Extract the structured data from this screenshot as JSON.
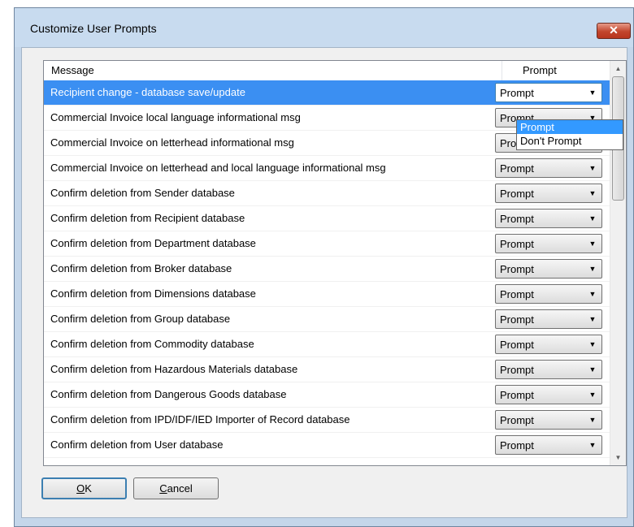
{
  "window": {
    "title": "Customize User Prompts",
    "close_glyph": "✕"
  },
  "grid": {
    "columns": [
      "Message",
      "Prompt"
    ],
    "rows": [
      {
        "message": "Recipient change - database save/update",
        "prompt": "Prompt"
      },
      {
        "message": "Commercial Invoice local language informational msg",
        "prompt": "Prompt"
      },
      {
        "message": "Commercial Invoice on letterhead informational msg",
        "prompt": "Prompt"
      },
      {
        "message": "Commercial Invoice on letterhead and local language informational msg",
        "prompt": "Prompt"
      },
      {
        "message": "Confirm deletion from Sender database",
        "prompt": "Prompt"
      },
      {
        "message": "Confirm deletion from Recipient database",
        "prompt": "Prompt"
      },
      {
        "message": "Confirm deletion from Department database",
        "prompt": "Prompt"
      },
      {
        "message": "Confirm deletion from Broker database",
        "prompt": "Prompt"
      },
      {
        "message": "Confirm deletion from Dimensions database",
        "prompt": "Prompt"
      },
      {
        "message": "Confirm deletion from Group database",
        "prompt": "Prompt"
      },
      {
        "message": "Confirm deletion from Commodity database",
        "prompt": "Prompt"
      },
      {
        "message": "Confirm deletion from Hazardous Materials database",
        "prompt": "Prompt"
      },
      {
        "message": "Confirm deletion from Dangerous Goods database",
        "prompt": "Prompt"
      },
      {
        "message": "Confirm deletion from IPD/IDF/IED Importer of Record database",
        "prompt": "Prompt"
      },
      {
        "message": "Confirm deletion from User database",
        "prompt": "Prompt"
      }
    ],
    "dropdown_options": [
      "Prompt",
      "Don't Prompt"
    ],
    "highlighted_option": "Prompt"
  },
  "buttons": {
    "ok": {
      "mnemonic": "O",
      "rest": "K"
    },
    "cancel": {
      "mnemonic": "C",
      "rest": "ancel"
    }
  },
  "colors": {
    "selection": "#3b8ff2",
    "title_bar": "#c8dbef",
    "close_button": "#c2452c"
  },
  "icons": {
    "close": "close-icon",
    "combo_arrow": "chevron-down-icon",
    "scroll_up": "scroll-up-arrow-icon",
    "scroll_down": "scroll-down-arrow-icon"
  }
}
